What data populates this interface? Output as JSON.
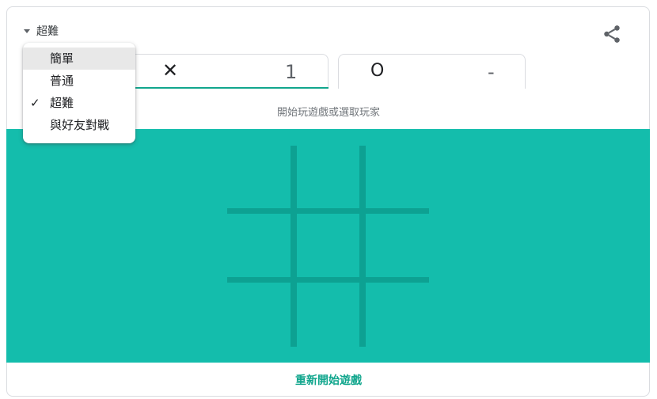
{
  "difficulty": {
    "selected_label": "超難",
    "menu_items": [
      {
        "label": "簡單",
        "checked": false,
        "highlighted": true
      },
      {
        "label": "普通",
        "checked": false,
        "highlighted": false
      },
      {
        "label": "超難",
        "checked": true,
        "highlighted": false
      },
      {
        "label": "與好友對戰",
        "checked": false,
        "highlighted": false
      }
    ],
    "check_glyph": "✓"
  },
  "scoreboard": {
    "x_mark": "✕",
    "x_score": "1",
    "o_mark": "O",
    "o_score": "-"
  },
  "hint": "開始玩遊戲或選取玩家",
  "restart_label": "重新開始遊戲",
  "icons": {
    "share": "share-icon",
    "caret": "caret-down-icon"
  },
  "colors": {
    "board": "#14bdac",
    "grid_lines": "#0da192",
    "accent": "#11a68d"
  }
}
